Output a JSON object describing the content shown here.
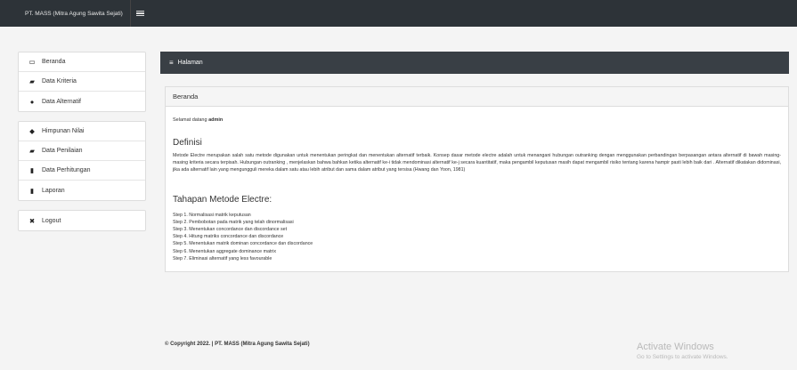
{
  "header": {
    "brand": "PT. MASS (Mitra Agung Sawita Sejati)"
  },
  "sidebar": {
    "groups": [
      [
        {
          "label": "Beranda"
        },
        {
          "label": "Data Kriteria"
        },
        {
          "label": "Data Alternatif"
        }
      ],
      [
        {
          "label": "Himpunan Nilai"
        },
        {
          "label": "Data Penilaian"
        },
        {
          "label": "Data Perhitungan"
        },
        {
          "label": "Laporan"
        }
      ],
      [
        {
          "label": "Logout"
        }
      ]
    ]
  },
  "page": {
    "title": "Halaman"
  },
  "panel": {
    "heading": "Beranda",
    "welcome_prefix": "Selamat datang ",
    "welcome_user": "admin",
    "definisi_title": "Definisi",
    "definisi_text": "Metode Electre merupakan salah satu metode digunakan untuk menentukan peringkat dan menentukan alternatif terbaik. Konsep dasar metode electre adalah untuk menangani hubungan outranking dengan menggunakan perbandingan berpasangan antara alternatif di bawah masing-masing kriteria secara terpisah. Hubungan outranking , menjelaskan bahwa bahkan ketika alternatif ke-i tidak mendominasi alternatif ke-j secara kuantitatif, maka pengambil keputusan masih dapat mengambil risiko tentang karena hampir pasti lebih baik dari . Alternatif dikatakan didominasi, jika ada alternatif lain yang mengungguli mereka dalam satu atau lebih atribut dan sama dalam atribut yang tersisa (Hwang dan Yoon, 1981)",
    "tahapan_title": "Tahapan Metode Electre:",
    "steps": [
      "Step 1. Normalisasi matrik keputusan",
      "Step 2. Pembobotan pada matrik yang telah dinormalisasi",
      "Step 3. Menentukan concordance dan discordance set",
      "Step 4. Hitung matriks concordance dan discordance",
      "Step 5. Menentukan matrik dominan concordance dan discordance",
      "Step 6. Menentukan aggregate dominance matrix",
      "Step 7. Eliminasi alternatif yang less favourable"
    ]
  },
  "footer": {
    "copyright": "© Copyright 2022. | PT. MASS (Mitra Agung Sawita Sejati)"
  },
  "watermark": {
    "line1": "Activate Windows",
    "line2": "Go to Settings to activate Windows."
  }
}
